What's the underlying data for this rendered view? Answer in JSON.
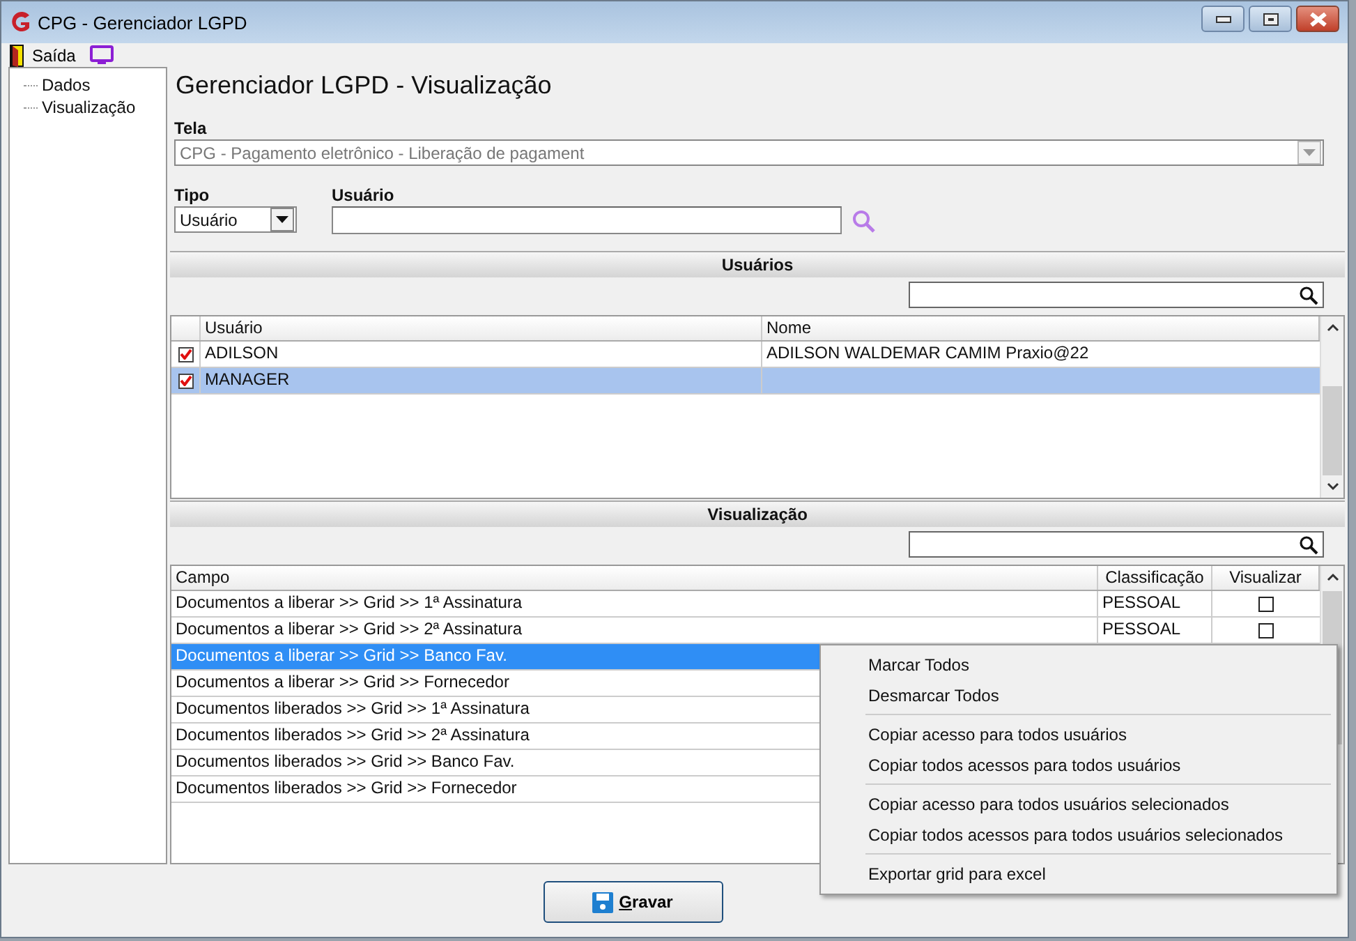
{
  "window": {
    "title": "CPG - Gerenciador LGPD"
  },
  "menu": [
    {
      "label": "Saída",
      "kind": "exit"
    },
    {
      "kind": "screen"
    }
  ],
  "tree": [
    {
      "label": "Dados"
    },
    {
      "label": "Visualização"
    }
  ],
  "heading": "Gerenciador LGPD - Visualização",
  "tela": {
    "label": "Tela",
    "value": "CPG - Pagamento eletrônico - Liberação de pagament",
    "disabled": true
  },
  "tipo": {
    "label": "Tipo",
    "value": "Usuário"
  },
  "usuario": {
    "label": "Usuário"
  },
  "users_section": {
    "title": "Usuários",
    "columns": [
      "Usuário",
      "Nome"
    ],
    "rows": [
      {
        "checked": true,
        "selected": false,
        "usuario": "ADILSON",
        "nome": "ADILSON WALDEMAR CAMIM Praxio@22"
      },
      {
        "checked": true,
        "selected": true,
        "usuario": "MANAGER"
      }
    ]
  },
  "view_section": {
    "title": "Visualização",
    "columns": [
      "Campo",
      "Classificação",
      "Visualizar"
    ],
    "rows": [
      {
        "selected": false,
        "campo": "Documentos a liberar >> Grid >> 1ª Assinatura",
        "classificacao": "PESSOAL",
        "visualizar": false
      },
      {
        "selected": false,
        "campo": "Documentos a liberar >> Grid >> 2ª Assinatura",
        "classificacao": "PESSOAL",
        "visualizar": false
      },
      {
        "selected": true,
        "campo": "Documentos a liberar >> Grid >> Banco Fav."
      },
      {
        "selected": false,
        "campo": "Documentos a liberar >> Grid >> Fornecedor"
      },
      {
        "selected": false,
        "campo": "Documentos liberados >> Grid >> 1ª Assinatura"
      },
      {
        "selected": false,
        "campo": "Documentos liberados >> Grid >> 2ª Assinatura"
      },
      {
        "selected": false,
        "campo": "Documentos liberados >> Grid >> Banco Fav."
      },
      {
        "selected": false,
        "campo": "Documentos liberados >> Grid >> Fornecedor"
      }
    ]
  },
  "context_menu": [
    {
      "kind": "item",
      "label": "Marcar Todos"
    },
    {
      "kind": "item",
      "label": "Desmarcar Todos"
    },
    {
      "kind": "separator"
    },
    {
      "kind": "item",
      "label": "Copiar acesso para todos usuários"
    },
    {
      "kind": "item",
      "label": "Copiar todos acessos para todos usuários"
    },
    {
      "kind": "separator"
    },
    {
      "kind": "item",
      "label": "Copiar acesso para todos usuários selecionados"
    },
    {
      "kind": "item",
      "label": "Copiar todos acessos para todos usuários selecionados"
    },
    {
      "kind": "separator"
    },
    {
      "kind": "item",
      "label": "Exportar grid para excel"
    }
  ],
  "save_button": {
    "label": "Gravar"
  }
}
